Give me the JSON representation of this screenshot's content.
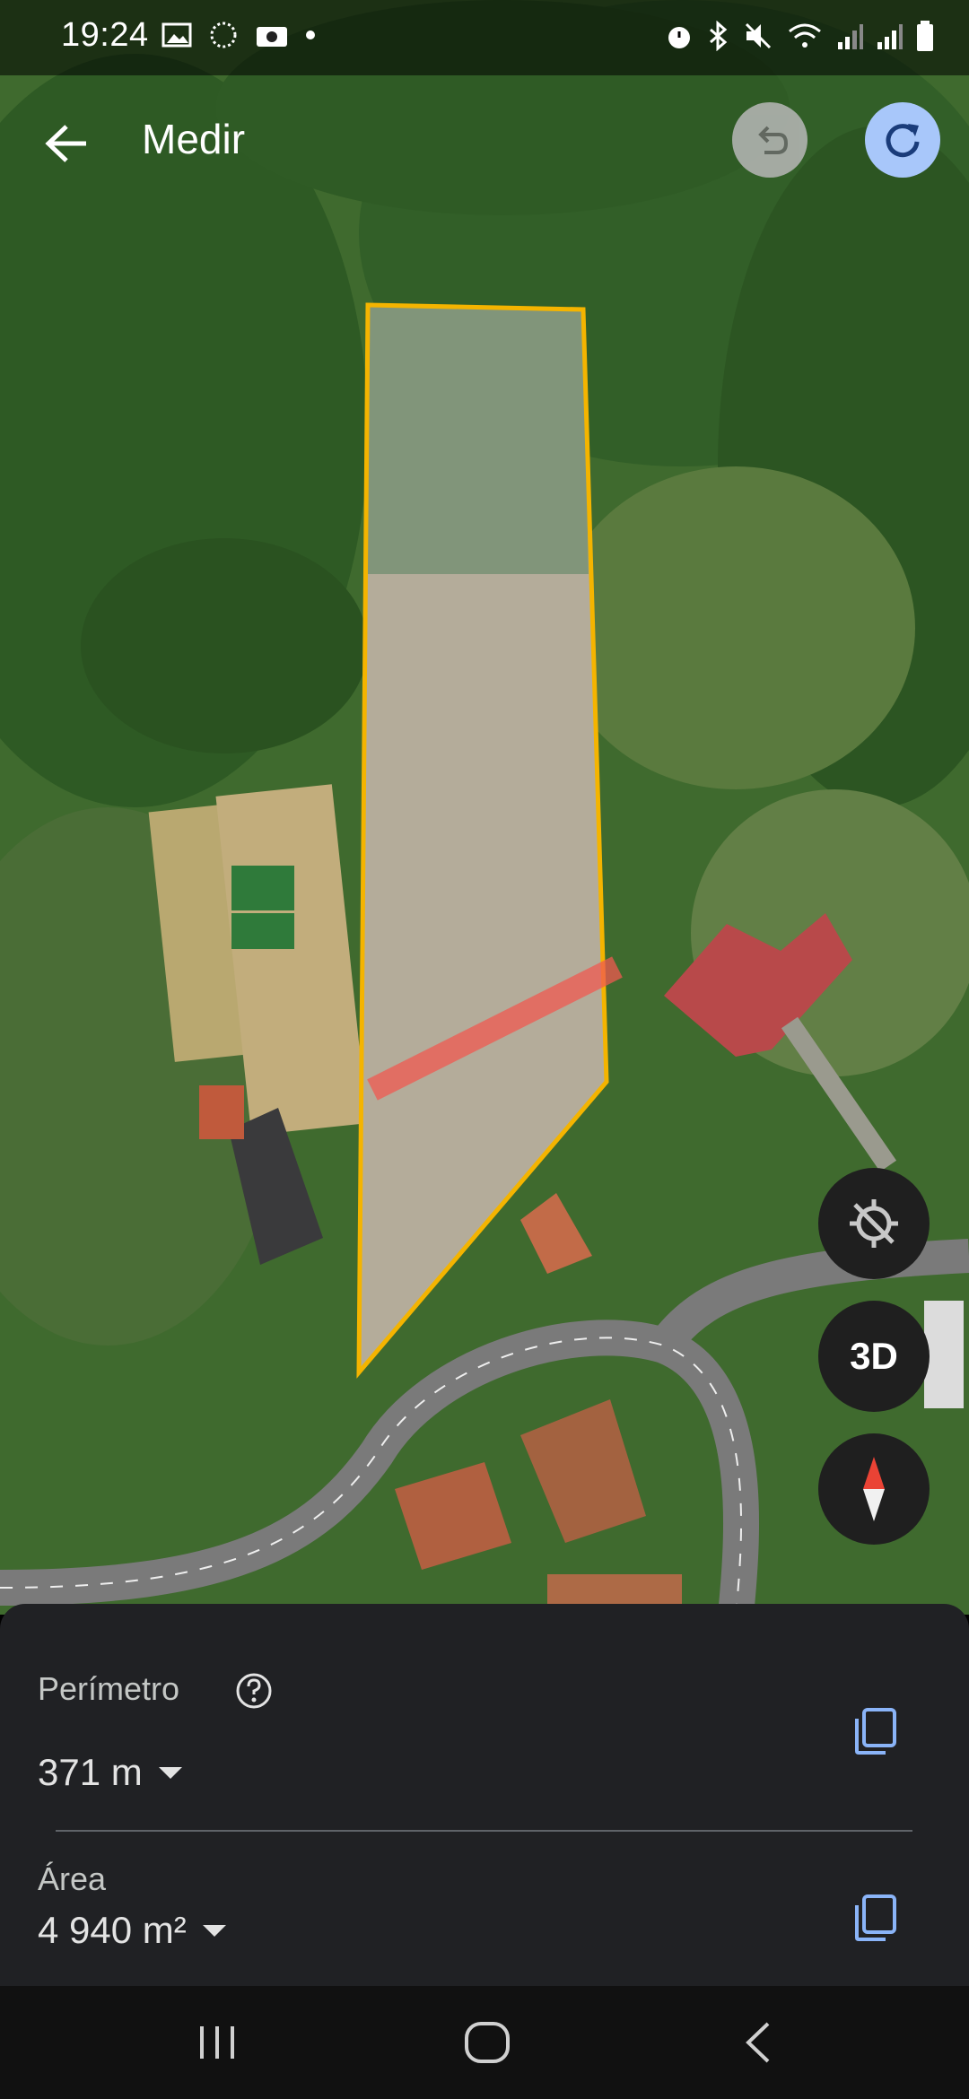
{
  "status_bar": {
    "time": "19:24",
    "left_icons": [
      "gallery-icon",
      "loading-icon",
      "camera-icon",
      "dot-icon"
    ],
    "right_icons": [
      "alarm-icon",
      "bluetooth-icon",
      "mute-icon",
      "wifi-icon",
      "signal-icon",
      "signal-icon",
      "battery-icon"
    ]
  },
  "top_bar": {
    "title": "Medir",
    "back_icon": "arrow-left-icon",
    "undo_icon": "undo-icon",
    "redo_icon": "redo-icon"
  },
  "map_controls": {
    "location_icon": "location-off-icon",
    "view_3d_label": "3D",
    "compass_icon": "compass-icon"
  },
  "measurement": {
    "perimeter_label": "Perímetro",
    "perimeter_value": "371 m",
    "area_label": "Área",
    "area_value": "4 940 m²",
    "help_icon": "help-icon",
    "copy_icon": "copy-icon"
  },
  "nav_bar": {
    "recents_icon": "recents-icon",
    "home_icon": "home-icon",
    "back_icon": "nav-back-icon"
  },
  "colors": {
    "outline": "#f4b400",
    "accent": "#a8c7fa",
    "sheet_bg": "#202124",
    "copy_icon": "#8ab4f8"
  }
}
